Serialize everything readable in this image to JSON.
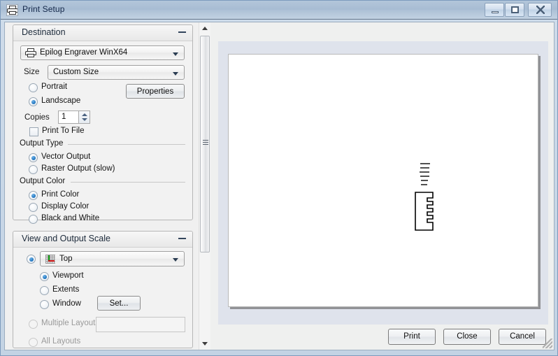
{
  "window": {
    "title": "Print Setup",
    "icon": "printer-icon",
    "controls": {
      "minimize": "minimize-icon",
      "maximize": "maximize-icon",
      "close": "close-icon"
    }
  },
  "destination": {
    "header": "Destination",
    "collapse_icon": "minimize-group-icon",
    "printer": {
      "value": "Epilog Engraver WinX64",
      "icon": "printer-icon"
    },
    "size": {
      "label": "Size",
      "value": "Custom Size"
    },
    "orientation": {
      "portrait": "Portrait",
      "landscape": "Landscape",
      "selected": "Landscape"
    },
    "properties_button": "Properties",
    "copies": {
      "label": "Copies",
      "value": "1"
    },
    "print_to_file": {
      "label": "Print To File",
      "checked": false
    },
    "output_type": {
      "legend": "Output Type",
      "options": [
        "Vector Output",
        "Raster Output (slow)"
      ],
      "selected": "Vector Output"
    },
    "output_color": {
      "legend": "Output Color",
      "options": [
        "Print Color",
        "Display Color",
        "Black and White"
      ],
      "selected": "Print Color"
    }
  },
  "view_scale": {
    "header": "View and Output Scale",
    "collapse_icon": "minimize-group-icon",
    "view_combo": {
      "value": "Top",
      "icon": "grid-axes-icon",
      "selected": true
    },
    "sub_options": {
      "options": [
        "Viewport",
        "Extents",
        "Window"
      ],
      "selected": "Viewport"
    },
    "set_button": "Set...",
    "multiple_layouts": {
      "label": "Multiple Layouts",
      "value": "",
      "enabled": false
    },
    "all_layouts": {
      "label": "All Layouts",
      "enabled": false
    }
  },
  "scrollbar": {
    "up_icon": "scroll-up-arrow-icon",
    "down_icon": "scroll-down-arrow-icon",
    "grip_icon": "scroll-grip-icon"
  },
  "preview": {
    "name": "print-preview",
    "page_color": "#ffffff",
    "backing_color": "#dfe3ec",
    "drawing": {
      "description": "rectangle with comb teeth on right edge and small dimension text above",
      "line_color": "#000000"
    }
  },
  "actions": {
    "print": "Print",
    "close": "Close",
    "cancel": "Cancel"
  },
  "colors": {
    "titlebar_start": "#b3c6da",
    "titlebar_end": "#c2d2e2",
    "window_border": "#7d9bbd",
    "client_bg": "#f0f0f0",
    "accent_radio": "#1d72bd",
    "preview_backing": "#dfe3ec"
  }
}
